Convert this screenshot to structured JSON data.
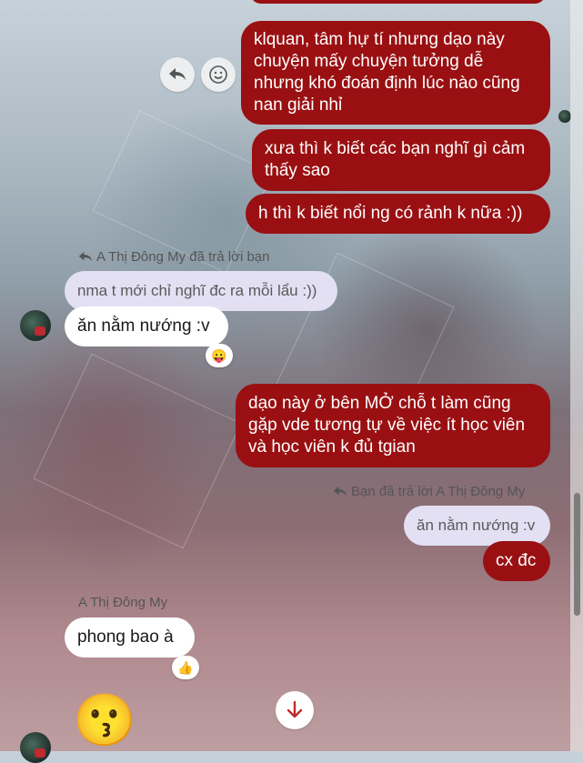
{
  "messages": {
    "sent_1": "klquan, tâm hự tí nhưng dạo này chuyện mấy chuyện tưởng dễ nhưng khó đoán định lúc nào cũng nan giải nhỉ",
    "sent_1_lines": [
      "klquan, tâm hự tí nhưng dạo này",
      "chuyện mấy chuyện tưởng dễ",
      "nhưng khó đoán định lúc nào cũng",
      "nan giải nhỉ"
    ],
    "sent_2_lines": [
      "xưa thì k biết các bạn nghĩ gì cảm",
      "thấy sao"
    ],
    "sent_3": "h thì k biết nổi ng có rảnh k nữa :))",
    "reply_label_1": "A Thị Đông My đã trả lời bạn",
    "quoted_1": "nma t mới chỉ nghĩ đc ra mỗi lẩu :))",
    "recv_1": "ăn nằm nướng :v",
    "reaction_1": "😛",
    "sent_4_lines": [
      "dạo này ở bên MỞ chỗ t làm cũng",
      "gặp vde tương tự về việc ít học viên",
      "và học viên k đủ tgian"
    ],
    "reply_label_2": "Bạn đã trả lời A Thị Đông My",
    "quoted_2": "ăn nằm nướng :v",
    "sent_5": "cx đc",
    "sender_name": "A Thị Đông My",
    "recv_2": "phong bao à",
    "reaction_2": "👍",
    "big_emoji": "😗"
  },
  "icons": {
    "reply": "reply-arrow-icon",
    "react": "smiley-icon",
    "scroll_down": "arrow-down-icon"
  },
  "colors": {
    "sent_bubble": "#9a1012",
    "received_bubble": "#ffffff",
    "quoted_bubble": "#e3e0f4",
    "scroll_arrow": "#c0292f"
  }
}
